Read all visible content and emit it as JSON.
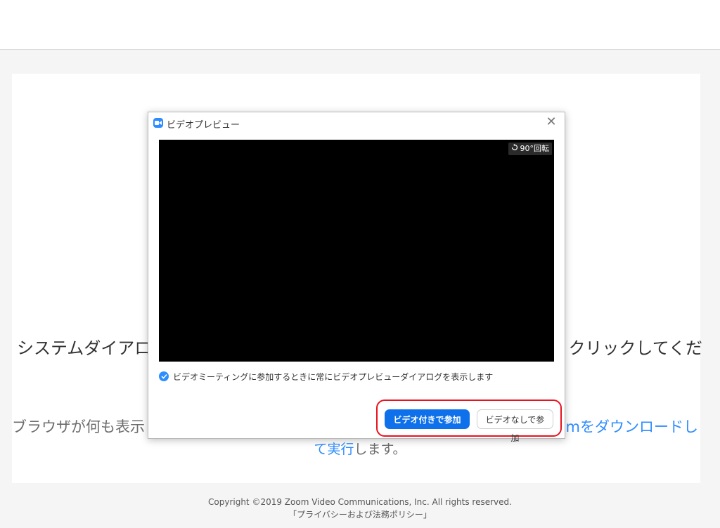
{
  "page": {
    "line1_left": "システムダイアロ",
    "line1_right": "クリックしてくだ",
    "line2_left": "ブラウザが何も表示",
    "line2_right": "omをダウンロードし",
    "line3_link": "て実行",
    "line3_rest": "します。",
    "footer_copyright": "Copyright ©2019 Zoom Video Communications, Inc. All rights reserved.",
    "footer_policy": "「プライバシーおよび法務ポリシー」"
  },
  "dialog": {
    "title": "ビデオプレビュー",
    "close_symbol": "✕",
    "rotate_label": "90°回転",
    "checkbox_label": "ビデオミーティングに参加するときに常にビデオプレビューダイアログを表示します",
    "checkbox_checked": true,
    "join_with_video": "ビデオ付きで参加",
    "join_without_video": "ビデオなしで参加"
  },
  "colors": {
    "accent": "#2D8CFF",
    "primary_button": "#0e71eb",
    "highlight": "#e8131e"
  },
  "icons": [
    "zoom-app-icon",
    "close-icon",
    "rotate-icon",
    "check-icon"
  ]
}
